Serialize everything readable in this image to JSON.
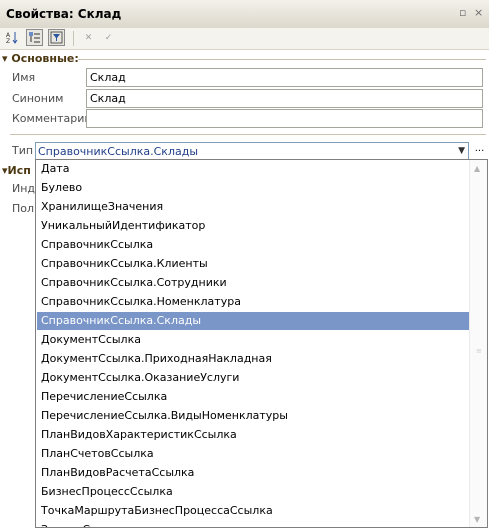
{
  "window": {
    "title": "Свойства: Склад",
    "pin_glyph": "▫",
    "close_glyph": "×"
  },
  "toolbar": {
    "sort_icon": "sort-az-icon",
    "categories_icon": "categories-icon",
    "filter_icon": "filter-icon",
    "delete_glyph": "✕",
    "confirm_glyph": "✓"
  },
  "group": {
    "basic_label": "Основные:"
  },
  "fields": {
    "name_label": "Имя",
    "name_value": "Склад",
    "synonym_label": "Синоним",
    "synonym_value": "Склад",
    "comment_label": "Комментарий",
    "comment_value": "",
    "type_label": "Тип",
    "type_value": "СправочникСсылка.Склады",
    "type_ellipsis": "..."
  },
  "background_labels": {
    "group_usage": "Исп",
    "indexing": "Инде",
    "fulltext": "Полн"
  },
  "dropdown": {
    "items": [
      "Дата",
      "Булево",
      "ХранилищеЗначения",
      "УникальныйИдентификатор",
      "СправочникСсылка",
      "СправочникСсылка.Клиенты",
      "СправочникСсылка.Сотрудники",
      "СправочникСсылка.Номенклатура",
      "СправочникСсылка.Склады",
      "ДокументСсылка",
      "ДокументСсылка.ПриходнаяНакладная",
      "ДокументСсылка.ОказаниеУслуги",
      "ПеречислениеСсылка",
      "ПеречислениеСсылка.ВидыНоменклатуры",
      "ПланВидовХарактеристикСсылка",
      "ПланСчетовСсылка",
      "ПланВидовРасчетаСсылка",
      "БизнесПроцессСсылка",
      "ТочкаМаршрутаБизнесПроцессаСсылка",
      "ЗадачаСсылка"
    ],
    "selected_item": "СправочникСсылка.Склады"
  },
  "colors": {
    "selection": "#7a96c8",
    "group_header": "#4c3812"
  }
}
